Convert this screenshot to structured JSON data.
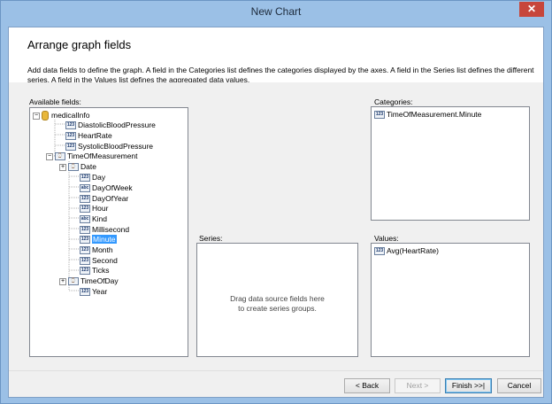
{
  "window": {
    "title": "New Chart",
    "close_glyph": "✕"
  },
  "header": {
    "title": "Arrange graph fields",
    "description": "Add data fields to define the graph. A field in the Categories list defines the categories displayed by the axes. A field in the Series list defines the different series. A field in the Values list defines the aggregated data values."
  },
  "available_fields": {
    "label": "Available fields:",
    "root": {
      "expander": "−",
      "label": "medicalInfo"
    },
    "fields": [
      {
        "icon": "123",
        "label": "DiastolicBloodPressure"
      },
      {
        "icon": "123",
        "label": "HeartRate"
      },
      {
        "icon": "123",
        "label": "SystolicBloodPressure"
      }
    ],
    "time_node": {
      "expander": "−",
      "icon": "⌚",
      "label": "TimeOfMeasurement"
    },
    "time_children": [
      {
        "expander": "+",
        "icon": "⌚",
        "label": "Date"
      },
      {
        "icon": "123",
        "label": "Day"
      },
      {
        "icon": "abc",
        "label": "DayOfWeek"
      },
      {
        "icon": "123",
        "label": "DayOfYear"
      },
      {
        "icon": "123",
        "label": "Hour"
      },
      {
        "icon": "abc",
        "label": "Kind"
      },
      {
        "icon": "123",
        "label": "Millisecond"
      },
      {
        "icon": "123",
        "label": "Minute",
        "selected": true
      },
      {
        "icon": "123",
        "label": "Month"
      },
      {
        "icon": "123",
        "label": "Second"
      },
      {
        "icon": "123",
        "label": "Ticks"
      },
      {
        "expander": "+",
        "icon": "⌚",
        "label": "TimeOfDay"
      },
      {
        "icon": "123",
        "label": "Year"
      }
    ]
  },
  "categories": {
    "label": "Categories:",
    "items": [
      {
        "icon": "123",
        "label": "TimeOfMeasurement.Minute"
      }
    ]
  },
  "series": {
    "label": "Series:",
    "placeholder_line1": "Drag data source fields here",
    "placeholder_line2": "to create series groups."
  },
  "values": {
    "label": "Values:",
    "items": [
      {
        "icon": "123",
        "label": "Avg(HeartRate)"
      }
    ]
  },
  "buttons": {
    "back": "< Back",
    "next": "Next >",
    "finish": "Finish >>|",
    "cancel": "Cancel"
  }
}
